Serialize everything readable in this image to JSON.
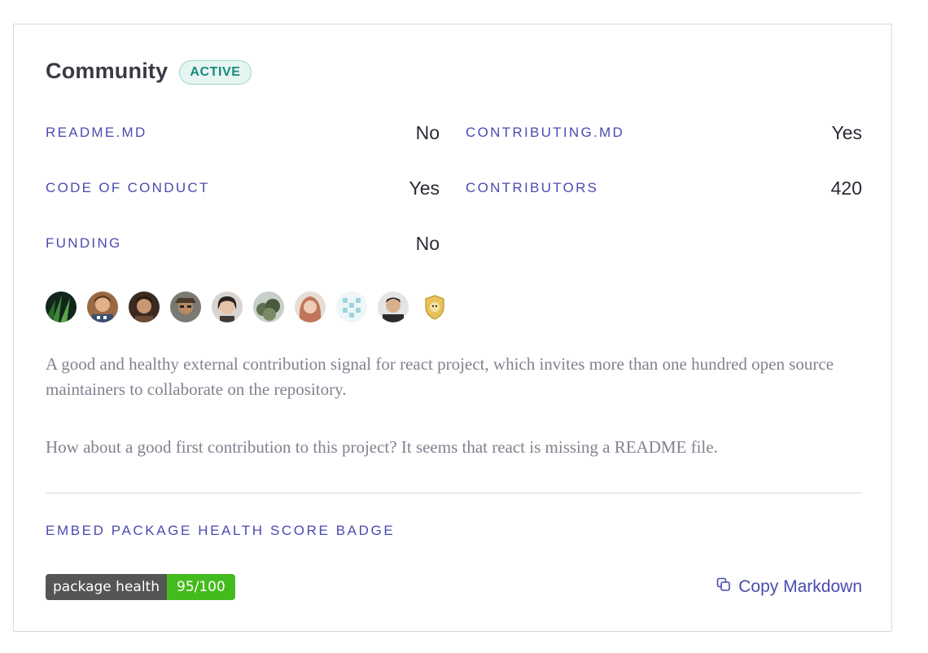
{
  "community": {
    "title": "Community",
    "status": "ACTIVE",
    "stats": [
      {
        "label": "README.MD",
        "value": "No"
      },
      {
        "label": "CONTRIBUTING.MD",
        "value": "Yes"
      },
      {
        "label": "CODE OF CONDUCT",
        "value": "Yes"
      },
      {
        "label": "CONTRIBUTORS",
        "value": "420"
      },
      {
        "label": "FUNDING",
        "value": "No"
      }
    ],
    "description": "A good and healthy external contribution signal for react project, which invites more than one hundred open source maintainers to collaborate on the repository.",
    "suggestion": "How about a good first contribution to this project? It seems that react is missing a README file."
  },
  "badge_section": {
    "title": "EMBED PACKAGE HEALTH SCORE BADGE",
    "badge_label": "package health",
    "badge_value": "95/100",
    "copy_label": "Copy Markdown",
    "copy_icon": "copy-icon"
  },
  "colors": {
    "accent": "#4b4bb0",
    "status_text": "#198a7a",
    "status_bg": "#e6f5f2",
    "badge_green": "#44bb1d",
    "badge_gray": "#555555"
  }
}
